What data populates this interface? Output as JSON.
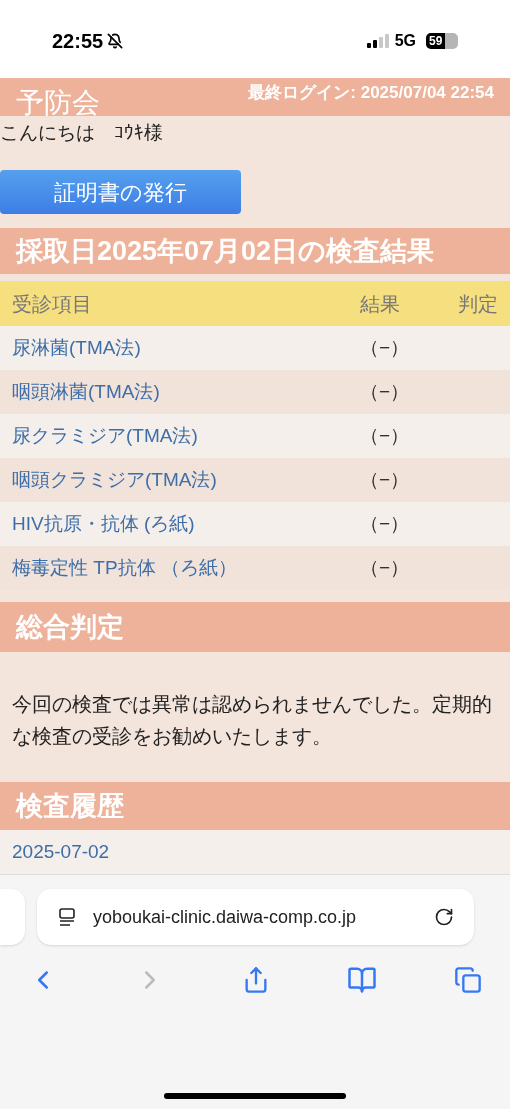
{
  "status_bar": {
    "time": "22:55",
    "network": "5G",
    "battery": "59"
  },
  "header": {
    "logo": "予防会",
    "last_login": "最終ログイン: 2025/07/04 22:54"
  },
  "greeting": "こんにちは　ｺｳｷ様",
  "certificate_button": "証明書の発行",
  "results_title": "採取日2025年07月02日の検査結果",
  "table": {
    "columns": [
      "受診項目",
      "結果",
      "判定"
    ],
    "rows": [
      {
        "item": "尿淋菌(TMA法)",
        "result": "（−）"
      },
      {
        "item": "咽頭淋菌(TMA法)",
        "result": "（−）"
      },
      {
        "item": "尿クラミジア(TMA法)",
        "result": "（−）"
      },
      {
        "item": "咽頭クラミジア(TMA法)",
        "result": "（−）"
      },
      {
        "item": "HIV抗原・抗体 (ろ紙)",
        "result": "（−）"
      },
      {
        "item": "梅毒定性 TP抗体 （ろ紙）",
        "result": "（−）"
      }
    ]
  },
  "summary": {
    "title": "総合判定",
    "text": "今回の検査では異常は認められませんでした。定期的な検査の受診をお勧めいたします。"
  },
  "history": {
    "title": "検査履歴",
    "dates": [
      "2025-07-02"
    ]
  },
  "browser": {
    "url": "yoboukai-clinic.daiwa-comp.co.jp"
  }
}
